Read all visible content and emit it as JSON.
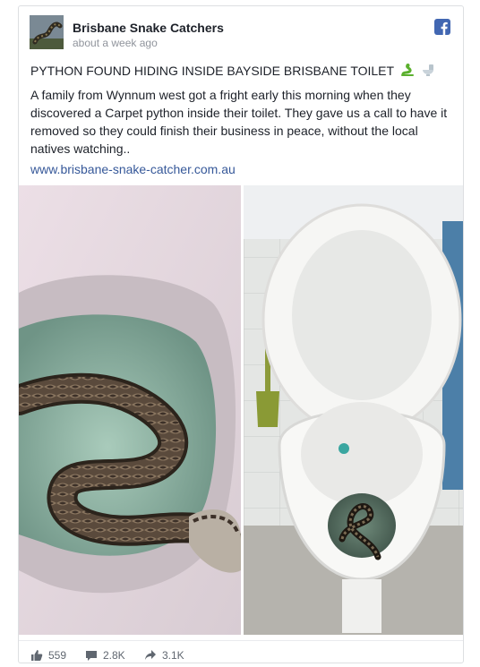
{
  "post": {
    "page_name": "Brisbane Snake Catchers",
    "timestamp": "about a week ago",
    "headline": "PYTHON FOUND HIDING INSIDE BAYSIDE BRISBANE TOILET",
    "body": "A family from Wynnum west got a fright early this morning when they discovered a Carpet python inside their toilet. They gave us a call to have it removed so they could finish their business in peace, without the local natives watching..",
    "link": "www.brisbane-snake-catcher.com.au",
    "headline_emojis": [
      "snake-emoji",
      "toilet-emoji"
    ]
  },
  "stats": {
    "likes": "559",
    "comments": "2.8K",
    "shares": "3.1K"
  },
  "colors": {
    "facebook_blue": "#4267b2",
    "link_blue": "#365899",
    "text": "#1d2129",
    "muted": "#90949c"
  },
  "icons": [
    "facebook-icon",
    "like-icon",
    "comment-icon",
    "share-icon"
  ]
}
